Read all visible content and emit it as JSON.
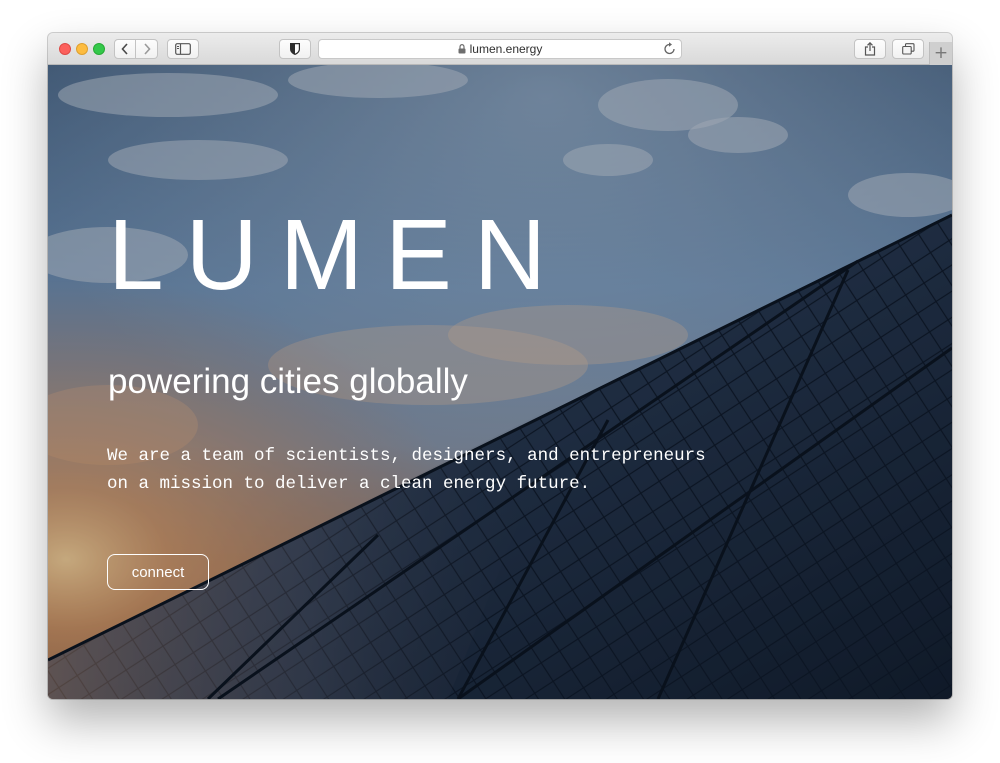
{
  "browser": {
    "url": "lumen.energy",
    "icons": {
      "back": "chevron-left-icon",
      "forward": "chevron-right-icon",
      "sidebar": "sidebar-icon",
      "extension": "shield-icon",
      "lock": "lock-icon",
      "reload": "reload-icon",
      "share": "share-icon",
      "tabs": "tabs-overview-icon",
      "new_tab": "plus-icon"
    },
    "new_tab_symbol": "+"
  },
  "hero": {
    "brand": "LUMEN",
    "tagline": "powering cities globally",
    "description_lines": [
      "We are a team of scientists, designers, and entrepreneurs",
      "on a mission to deliver a clean energy future."
    ],
    "cta_label": "connect"
  },
  "colors": {
    "text": "#ffffff",
    "sky_top": "#6f90b4",
    "panel": "#1a2638",
    "sunset": "#d9894a"
  }
}
